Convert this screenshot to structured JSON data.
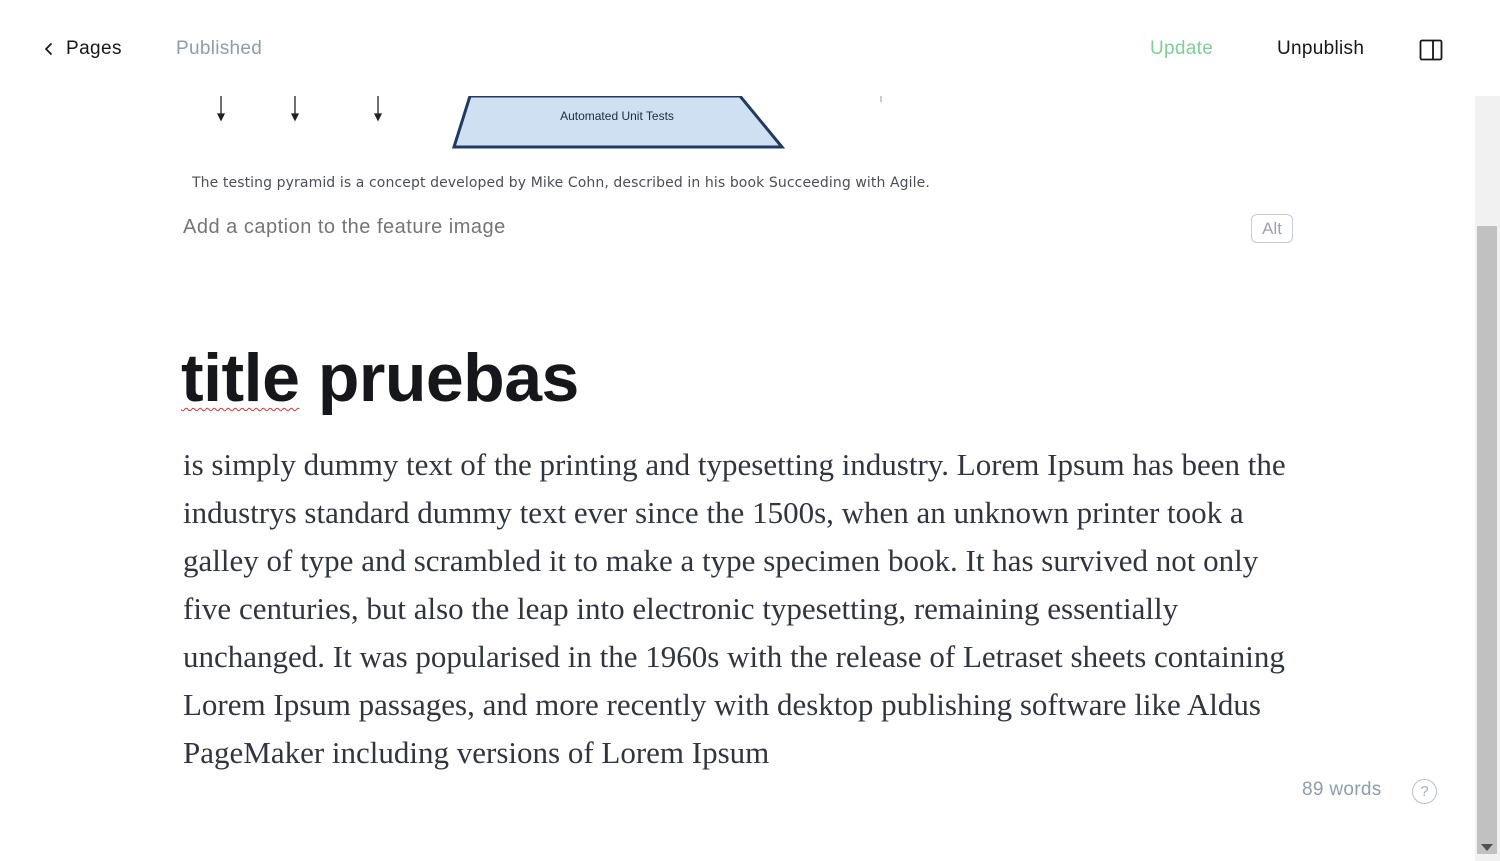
{
  "topbar": {
    "back_label": "Pages",
    "status": "Published",
    "update_label": "Update",
    "unpublish_label": "Unpublish"
  },
  "feature_image": {
    "pyramid_label": "Automated Unit Tests",
    "image_caption": "The testing pyramid is a concept developed by Mike Cohn, described in his book Succeeding with Agile.",
    "caption_placeholder": "Add a caption to the feature image",
    "alt_label": "Alt"
  },
  "post": {
    "title_word_1": "title",
    "title_word_2": "pruebas",
    "body": "is simply dummy text of the printing and typesetting industry. Lorem Ipsum has been the industrys standard dummy text ever since the 1500s, when an unknown printer took a galley of type and scrambled it to make a type specimen book. It has survived not only five centuries, but also the leap into electronic typesetting, remaining essentially unchanged. It was popularised in the 1960s with the release of Letraset sheets containing Lorem Ipsum passages, and more recently with desktop publishing software like Aldus PageMaker including versions of Lorem Ipsum"
  },
  "footer": {
    "word_count": "89 words",
    "help_symbol": "?"
  },
  "colors": {
    "accent_green": "#7fcf94",
    "muted": "#8e9cac",
    "spellcheck": "#e0302f"
  },
  "icons": {
    "back": "chevron-left-icon",
    "sidebar": "sidebar-toggle-icon",
    "help": "help-circle-icon"
  }
}
